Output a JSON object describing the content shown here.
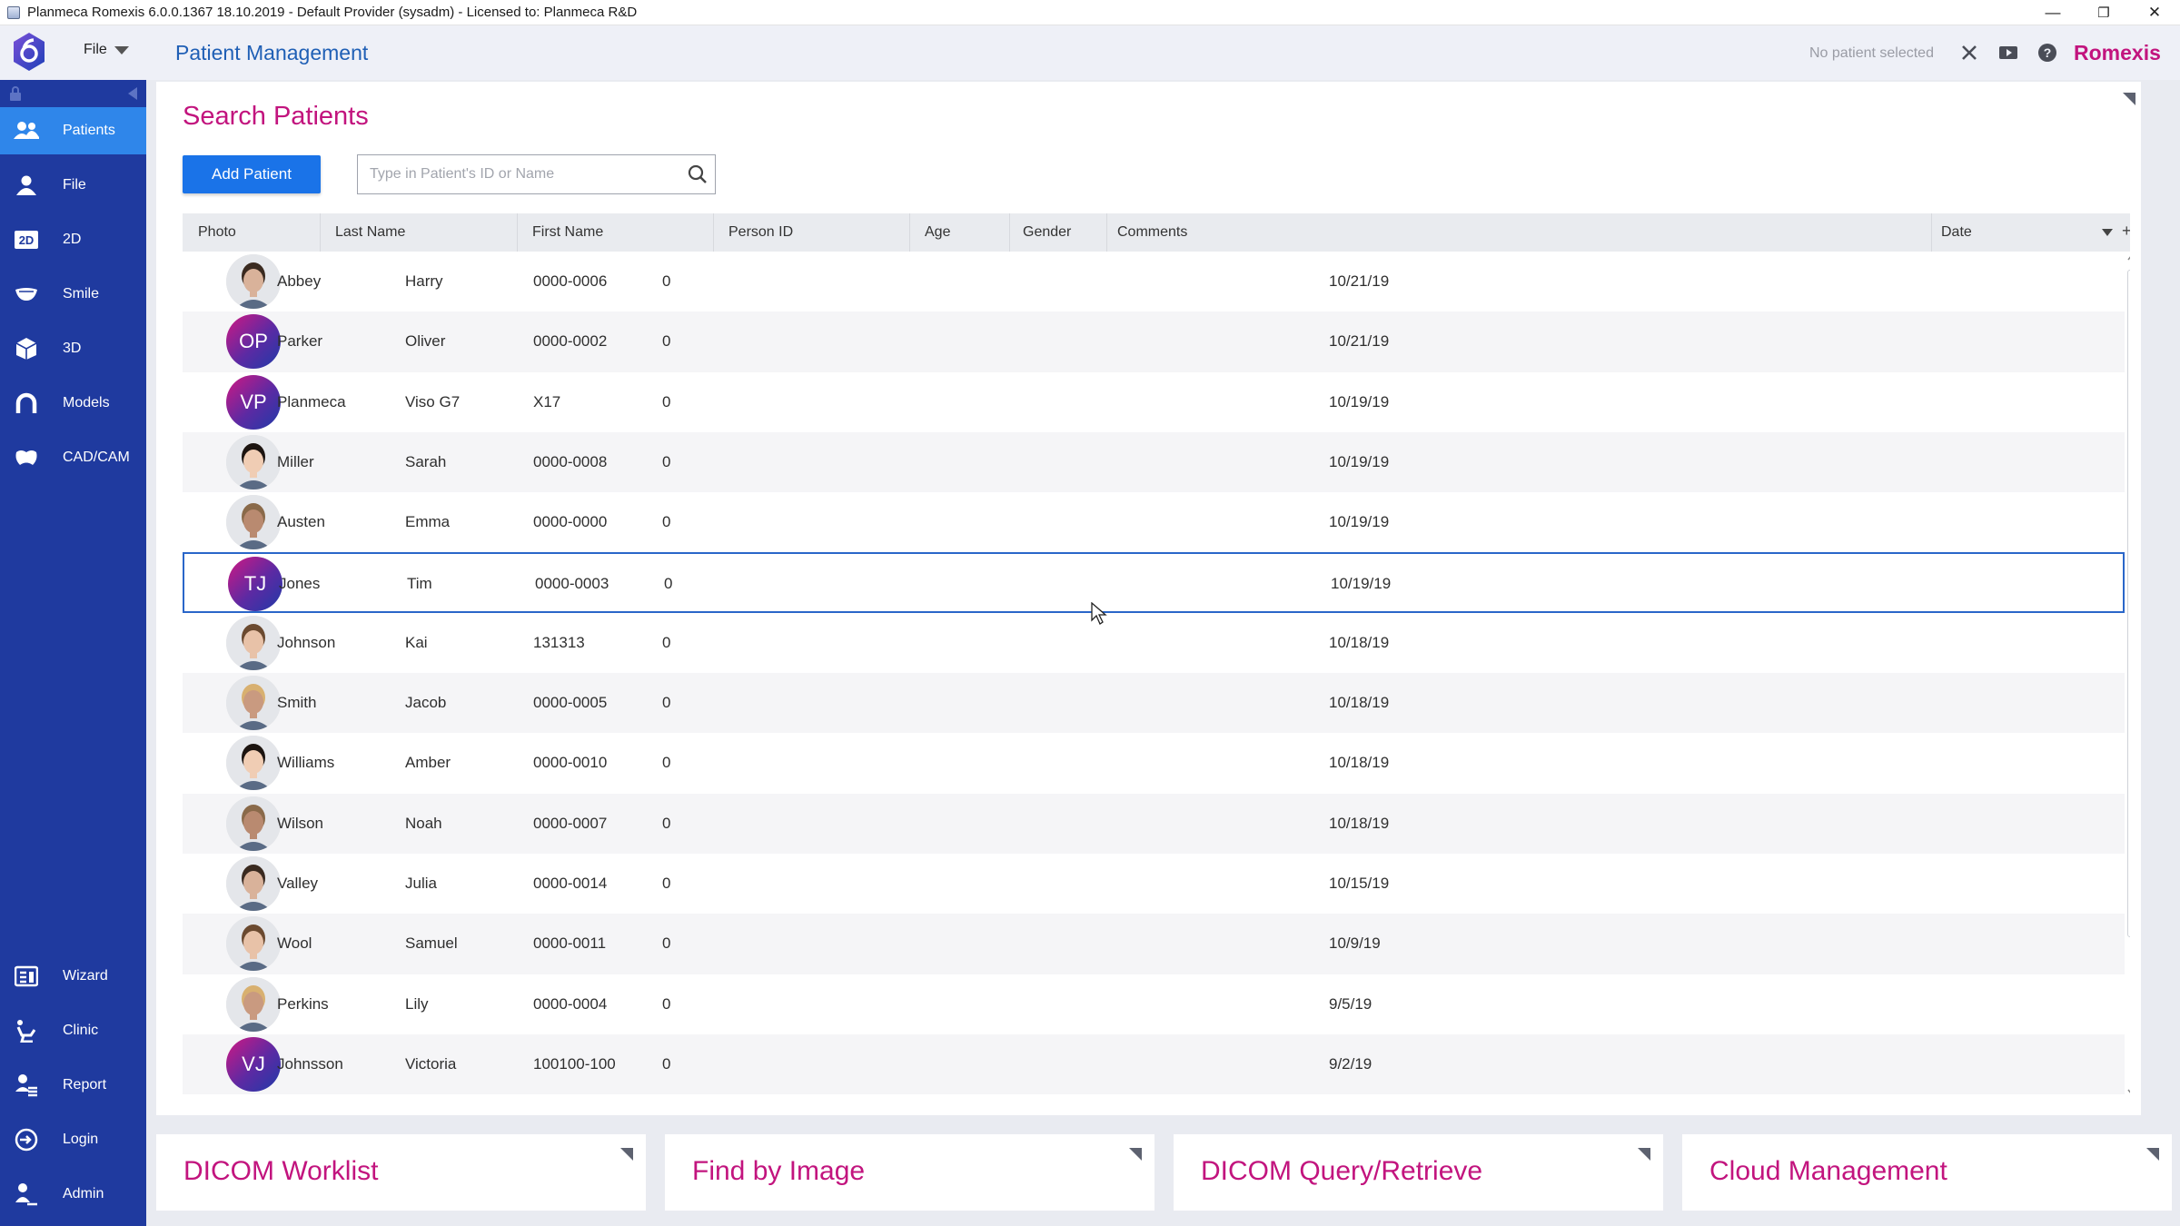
{
  "window": {
    "title": "Planmeca Romexis 6.0.0.1367 18.10.2019 - Default Provider (sysadm) - Licensed to: Planmeca R&D",
    "minimize": "—",
    "restore": "❐",
    "close": "✕"
  },
  "header": {
    "file_menu": "File",
    "page_title": "Patient Management",
    "patient_status": "No patient selected",
    "brand": "Romexis"
  },
  "sidebar": {
    "items": [
      {
        "label": "Patients",
        "icon": "patients-icon",
        "active": true
      },
      {
        "label": "File",
        "icon": "person-icon"
      },
      {
        "label": "2D",
        "icon": "2d-icon"
      },
      {
        "label": "Smile",
        "icon": "smile-icon"
      },
      {
        "label": "3D",
        "icon": "cube-icon"
      },
      {
        "label": "Models",
        "icon": "arch-icon"
      },
      {
        "label": "CAD/CAM",
        "icon": "tooth-icon"
      }
    ],
    "bottom_items": [
      {
        "label": "Wizard",
        "icon": "wizard-icon"
      },
      {
        "label": "Clinic",
        "icon": "dental-chair-icon"
      },
      {
        "label": "Report",
        "icon": "report-icon"
      },
      {
        "label": "Login",
        "icon": "login-icon"
      },
      {
        "label": "Admin",
        "icon": "admin-icon"
      }
    ]
  },
  "main": {
    "title": "Search Patients",
    "add_button": "Add Patient",
    "search_placeholder": "Type in Patient's ID or Name"
  },
  "table": {
    "columns": [
      "Photo",
      "Last Name",
      "First Name",
      "Person ID",
      "Age",
      "Gender",
      "Comments",
      "Date"
    ],
    "rows": [
      {
        "photo": "photo",
        "last": "Abbey",
        "first": "Harry",
        "id": "0000-0006",
        "age": "0",
        "gender": "",
        "comments": "",
        "date": "10/21/19"
      },
      {
        "photo": "OP",
        "last": "Parker",
        "first": "Oliver",
        "id": "0000-0002",
        "age": "0",
        "gender": "",
        "comments": "",
        "date": "10/21/19"
      },
      {
        "photo": "VP",
        "last": "Planmeca",
        "first": "Viso G7",
        "id": "X17",
        "age": "0",
        "gender": "",
        "comments": "",
        "date": "10/19/19"
      },
      {
        "photo": "photo",
        "last": "Miller",
        "first": "Sarah",
        "id": "0000-0008",
        "age": "0",
        "gender": "",
        "comments": "",
        "date": "10/19/19"
      },
      {
        "photo": "photo",
        "last": "Austen",
        "first": "Emma",
        "id": "0000-0000",
        "age": "0",
        "gender": "",
        "comments": "",
        "date": "10/19/19"
      },
      {
        "photo": "TJ",
        "last": "Jones",
        "first": "Tim",
        "id": "0000-0003",
        "age": "0",
        "gender": "",
        "comments": "",
        "date": "10/19/19",
        "selected": true
      },
      {
        "photo": "photo",
        "last": "Johnson",
        "first": "Kai",
        "id": "131313",
        "age": "0",
        "gender": "",
        "comments": "",
        "date": "10/18/19"
      },
      {
        "photo": "photo",
        "last": "Smith",
        "first": "Jacob",
        "id": "0000-0005",
        "age": "0",
        "gender": "",
        "comments": "",
        "date": "10/18/19"
      },
      {
        "photo": "photo",
        "last": "Williams",
        "first": "Amber",
        "id": "0000-0010",
        "age": "0",
        "gender": "",
        "comments": "",
        "date": "10/18/19"
      },
      {
        "photo": "photo",
        "last": "Wilson",
        "first": "Noah",
        "id": "0000-0007",
        "age": "0",
        "gender": "",
        "comments": "",
        "date": "10/18/19"
      },
      {
        "photo": "photo",
        "last": "Valley",
        "first": "Julia",
        "id": "0000-0014",
        "age": "0",
        "gender": "",
        "comments": "",
        "date": "10/15/19"
      },
      {
        "photo": "photo",
        "last": "Wool",
        "first": "Samuel",
        "id": "0000-0011",
        "age": "0",
        "gender": "",
        "comments": "",
        "date": "10/9/19"
      },
      {
        "photo": "photo",
        "last": "Perkins",
        "first": "Lily",
        "id": "0000-0004",
        "age": "0",
        "gender": "",
        "comments": "",
        "date": "9/5/19"
      },
      {
        "photo": "VJ",
        "last": "Johnsson",
        "first": "Victoria",
        "id": "100100-100",
        "age": "0",
        "gender": "",
        "comments": "",
        "date": "9/2/19"
      }
    ]
  },
  "panels": [
    {
      "title": "DICOM Worklist"
    },
    {
      "title": "Find by Image"
    },
    {
      "title": "DICOM Query/Retrieve"
    },
    {
      "title": "Cloud Management"
    }
  ],
  "colors": {
    "accent_magenta": "#c2147e",
    "sidebar_blue": "#1f3a9f",
    "active_blue": "#2f86ea",
    "button_blue": "#1a73e8"
  }
}
